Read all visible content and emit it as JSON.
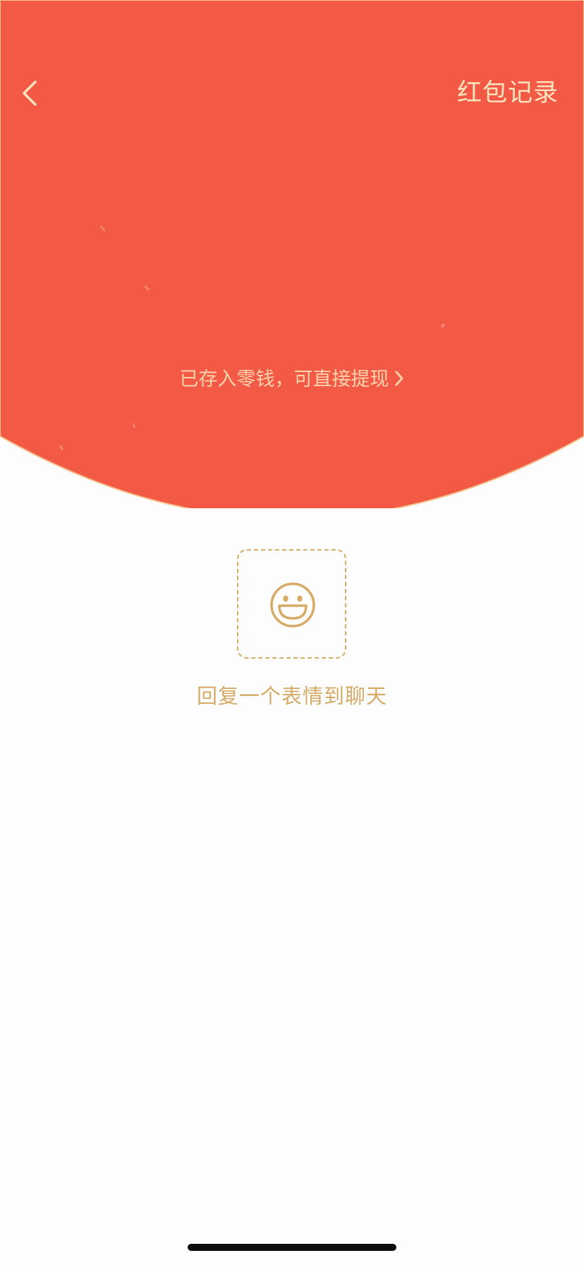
{
  "header": {
    "back_icon": "chevron-left-icon",
    "records_label": "红包记录",
    "background_color": "#f35a45",
    "rim_color": "#f8c592"
  },
  "wallet": {
    "notice": "已存入零钱，可直接提现",
    "chevron_icon": "chevron-right-icon"
  },
  "reply": {
    "sticker_icon": "smiley-face-icon",
    "label": "回复一个表情到聊天",
    "accent_color": "#d5ab66"
  }
}
